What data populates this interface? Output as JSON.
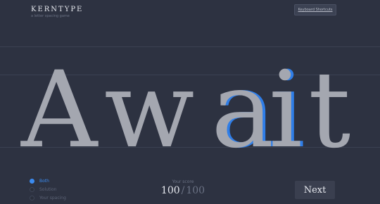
{
  "app": {
    "title": "KERNTYPE",
    "subtitle": "a letter spacing game"
  },
  "toolbar": {
    "shortcuts_label": "Keyboard Shortcuts"
  },
  "puzzle": {
    "word": "Await",
    "letters": [
      "A",
      "w",
      "a",
      "i",
      "t"
    ],
    "color_letters": "#a4a7b0",
    "color_solution_outline": "#2f7ee8"
  },
  "legend": {
    "items": [
      {
        "label": "Both",
        "active": true
      },
      {
        "label": "Solution",
        "active": false
      },
      {
        "label": "Your spacing",
        "active": false
      }
    ]
  },
  "score": {
    "label": "Your score",
    "value": "100",
    "separator": "/",
    "total": "100"
  },
  "navigation": {
    "next_label": "Next"
  },
  "colors": {
    "background": "#2d3241",
    "accent": "#3b8bf0",
    "button_bg": "#3a3f4f"
  }
}
